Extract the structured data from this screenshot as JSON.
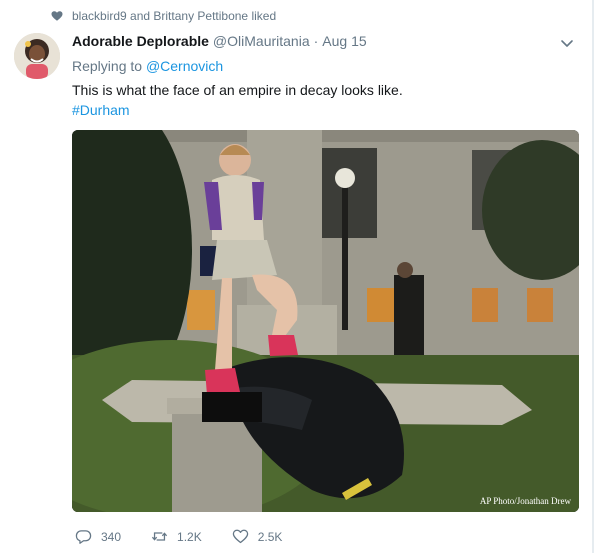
{
  "context": {
    "liked_text": "blackbird9 and Brittany Pettibone liked"
  },
  "tweet": {
    "name": "Adorable Deplorable",
    "handle": "@OliMauritania",
    "separator": "·",
    "time": "Aug 15",
    "replying_prefix": "Replying to",
    "replying_to": "@Cernovich",
    "text": "This is what the face of an empire in decay looks like.",
    "hashtag": "#Durham",
    "photo_credit": "AP Photo/Jonathan Drew"
  },
  "actions": {
    "reply_count": "340",
    "retweet_count": "1.2K",
    "like_count": "2.5K"
  },
  "colors": {
    "link": "#1b95e0",
    "muted": "#657786",
    "text": "#14171a"
  }
}
